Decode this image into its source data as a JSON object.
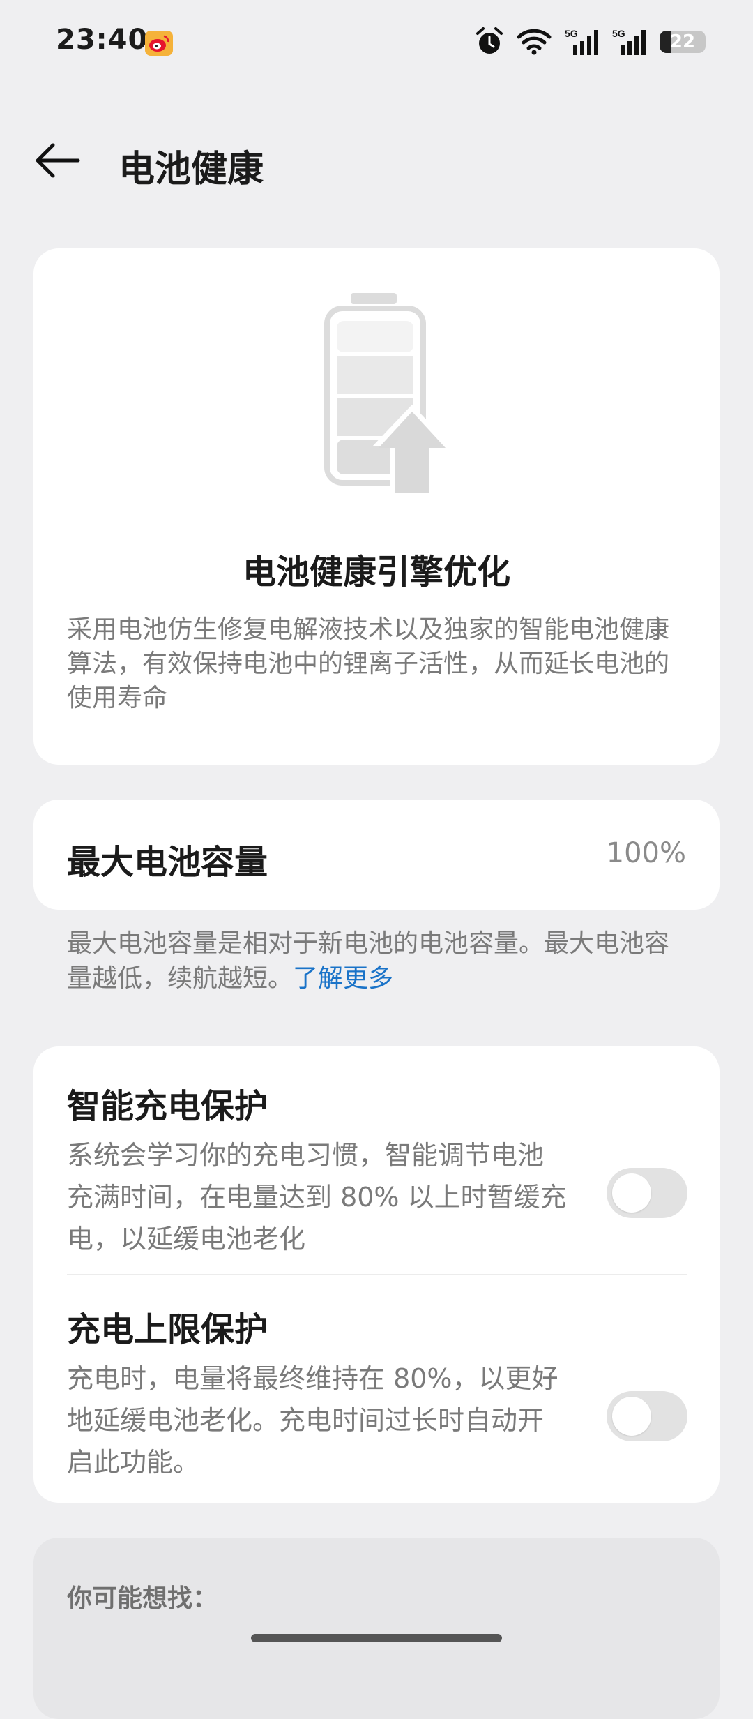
{
  "status_bar": {
    "time": "23:40",
    "battery_level": "22",
    "icons": [
      "weibo-icon",
      "alarm-icon",
      "wifi-icon",
      "signal-5g-icon",
      "signal-5g-icon",
      "battery-icon"
    ]
  },
  "header": {
    "title": "电池健康",
    "back_icon": "back-arrow-icon"
  },
  "hero": {
    "icon": "battery-upgrade-icon",
    "title": "电池健康引擎优化",
    "description": "采用电池仿生修复电解液技术以及独家的智能电池健康算法，有效保持电池中的锂离子活性，从而延长电池的使用寿命"
  },
  "capacity": {
    "label": "最大电池容量",
    "value": "100%",
    "note": "最大电池容量是相对于新电池的电池容量。最大电池容量越低，续航越短。",
    "learn_more": "了解更多"
  },
  "settings": [
    {
      "title": "智能充电保护",
      "description": "系统会学习你的充电习惯，智能调节电池充满时间，在电量达到 80% 以上时暂缓充电，以延缓电池老化",
      "enabled": false
    },
    {
      "title": "充电上限保护",
      "description": "充电时，电量将最终维持在 80%，以更好地延缓电池老化。充电时间过长时自动开启此功能。",
      "enabled": false
    }
  ],
  "suggestions": {
    "title": "你可能想找："
  },
  "colors": {
    "background": "#efeff1",
    "card": "#ffffff",
    "link": "#1a73c8",
    "secondary_text": "#7a7a7a",
    "toggle_off": "#e2e2e2"
  }
}
